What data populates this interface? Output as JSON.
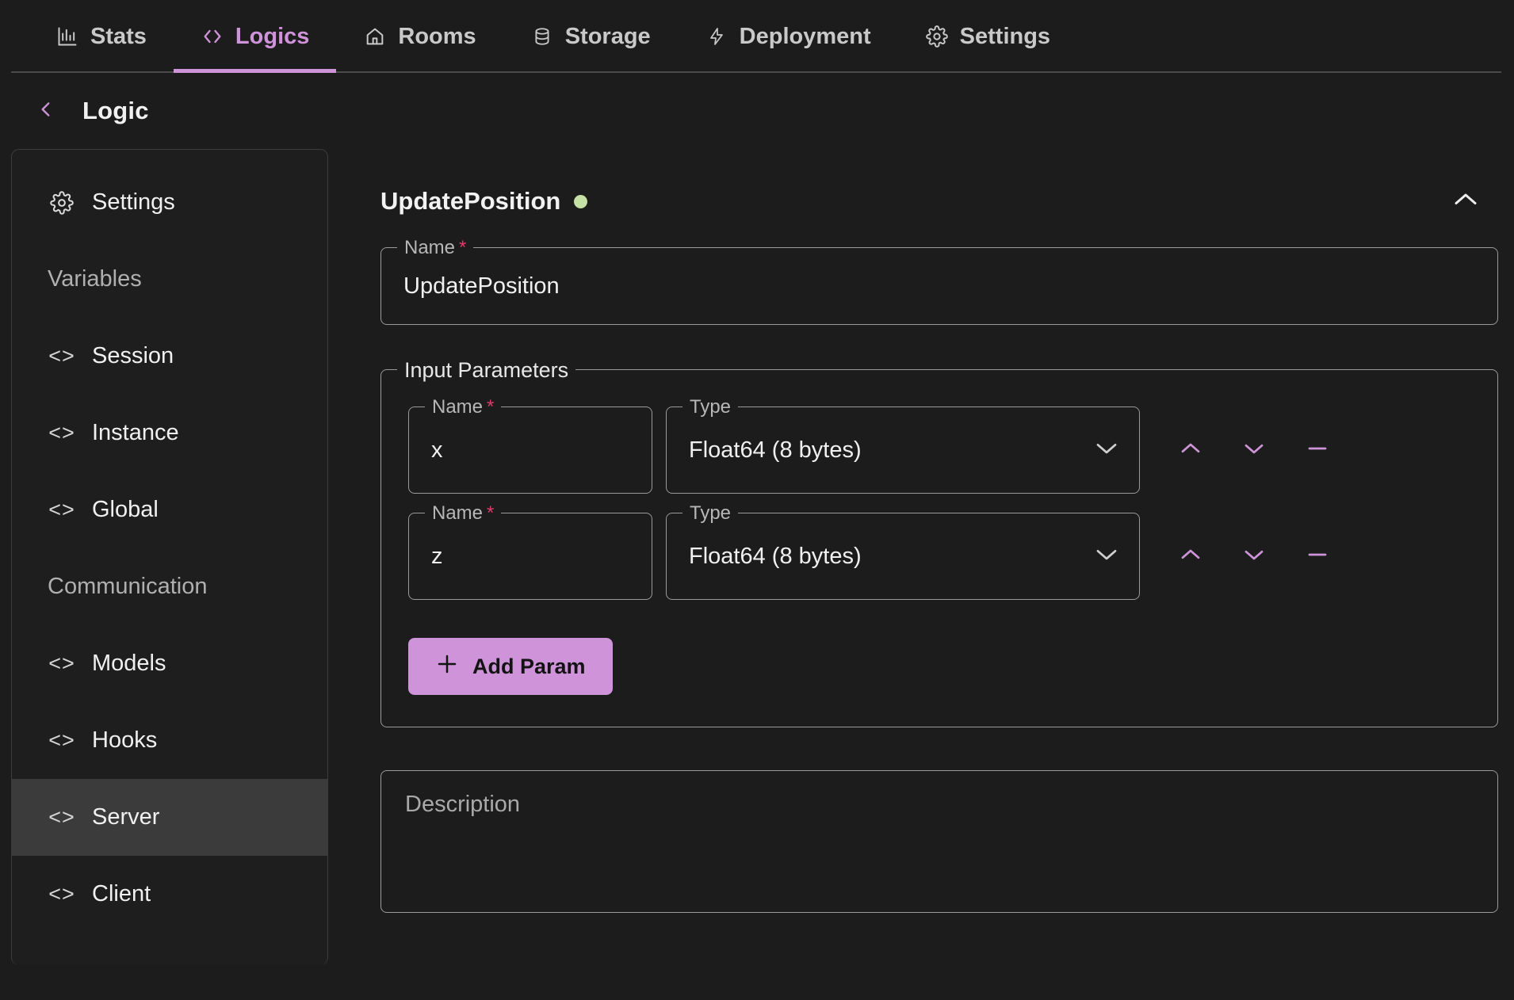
{
  "topnav": {
    "items": [
      {
        "label": "Stats",
        "icon": "bar-chart-icon",
        "active": false
      },
      {
        "label": "Logics",
        "icon": "code-brackets-icon",
        "active": true
      },
      {
        "label": "Rooms",
        "icon": "home-icon",
        "active": false
      },
      {
        "label": "Storage",
        "icon": "database-icon",
        "active": false
      },
      {
        "label": "Deployment",
        "icon": "lightning-bolt-icon",
        "active": false
      },
      {
        "label": "Settings",
        "icon": "gear-icon",
        "active": false
      }
    ]
  },
  "breadcrumb": {
    "back_icon": "chevron-left-icon",
    "title": "Logic"
  },
  "sidebar": {
    "items": [
      {
        "label": "Settings",
        "icon": "gear-icon",
        "type": "item",
        "selected": false
      },
      {
        "label": "Variables",
        "icon": "",
        "type": "group",
        "selected": false
      },
      {
        "label": "Session",
        "icon": "code-icon",
        "type": "item",
        "selected": false
      },
      {
        "label": "Instance",
        "icon": "code-icon",
        "type": "item",
        "selected": false
      },
      {
        "label": "Global",
        "icon": "code-icon",
        "type": "item",
        "selected": false
      },
      {
        "label": "Communication",
        "icon": "",
        "type": "group",
        "selected": false
      },
      {
        "label": "Models",
        "icon": "code-icon",
        "type": "item",
        "selected": false
      },
      {
        "label": "Hooks",
        "icon": "code-icon",
        "type": "item",
        "selected": false
      },
      {
        "label": "Server",
        "icon": "code-icon",
        "type": "item",
        "selected": true
      },
      {
        "label": "Client",
        "icon": "code-icon",
        "type": "item",
        "selected": false
      }
    ]
  },
  "logic_card": {
    "title": "UpdatePosition",
    "status_dot_color": "#c5e1a5",
    "collapse_icon": "chevron-up-icon",
    "name_field": {
      "label": "Name",
      "required_mark": "*",
      "value": "UpdatePosition"
    },
    "input_parameters": {
      "legend": "Input Parameters",
      "columns": {
        "name": "Name",
        "type": "Type",
        "required_mark": "*"
      },
      "rows": [
        {
          "name": "x",
          "type": "Float64 (8 bytes)",
          "actions": [
            {
              "name": "move-up",
              "icon": "chevron-up-icon"
            },
            {
              "name": "move-down",
              "icon": "chevron-down-icon"
            },
            {
              "name": "remove-param",
              "icon": "minus-icon"
            }
          ]
        },
        {
          "name": "z",
          "type": "Float64 (8 bytes)",
          "actions": [
            {
              "name": "move-up",
              "icon": "chevron-up-icon"
            },
            {
              "name": "move-down",
              "icon": "chevron-down-icon"
            },
            {
              "name": "remove-param",
              "icon": "minus-icon"
            }
          ]
        }
      ],
      "add_button": {
        "label": "Add Param",
        "icon": "plus-icon"
      }
    },
    "description": {
      "placeholder": "Description",
      "value": ""
    }
  },
  "colors": {
    "accent": "#ce93d8",
    "page_bg": "#1c1c1c",
    "panel_bg": "#1e1e1e",
    "selected_row": "#3b3b3b",
    "border": "#9a9a9a",
    "required": "#e5396b",
    "status_ok": "#c5e1a5"
  }
}
